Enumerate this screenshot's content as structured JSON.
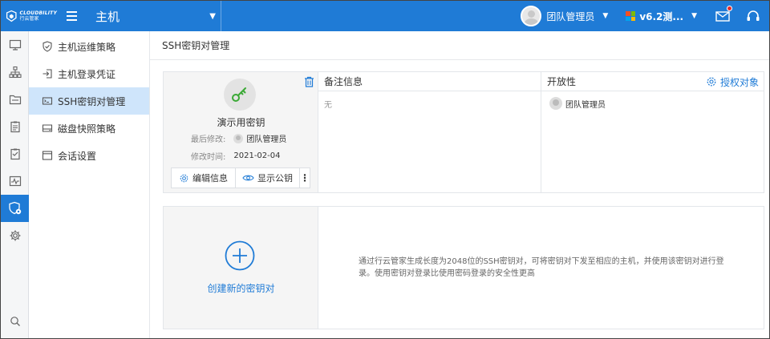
{
  "brand": {
    "name_en": "CLOUDBILITY",
    "name_cn": "行云管家"
  },
  "header": {
    "module": "主机",
    "user_name": "团队管理员",
    "version": "v6.2测..."
  },
  "colors": {
    "primary": "#1f7bd6",
    "active_menu": "#cfe5fb",
    "badge": "#e52b2b"
  },
  "rail": {
    "items": [
      {
        "icon": "monitor-icon"
      },
      {
        "icon": "topology-icon"
      },
      {
        "icon": "folder-icon"
      },
      {
        "icon": "clipboard-icon"
      },
      {
        "icon": "checklist-icon"
      },
      {
        "icon": "activity-icon"
      },
      {
        "icon": "shield-icon",
        "active": true
      },
      {
        "icon": "gear-icon"
      }
    ],
    "bottom": {
      "icon": "search-icon"
    }
  },
  "submenu": {
    "items": [
      {
        "label": "主机运维策略",
        "icon": "shield-check-icon"
      },
      {
        "label": "主机登录凭证",
        "icon": "login-icon"
      },
      {
        "label": "SSH密钥对管理",
        "icon": "key-icon",
        "active": true
      },
      {
        "label": "磁盘快照策略",
        "icon": "disk-icon"
      },
      {
        "label": "会话设置",
        "icon": "window-icon"
      }
    ]
  },
  "page": {
    "title": "SSH密钥对管理"
  },
  "key_card": {
    "name": "演示用密钥",
    "last_modified_label": "最后修改:",
    "last_modified_by": "团队管理员",
    "modified_time_label": "修改时间:",
    "modified_time": "2021-02-04",
    "edit_label": "编辑信息",
    "show_pubkey_label": "显示公钥",
    "more_label": "⋮",
    "notes_header": "备注信息",
    "notes_value": "无",
    "openness_header": "开放性",
    "authorize_label": "授权对象",
    "owner": "团队管理员"
  },
  "create_card": {
    "label": "创建新的密钥对",
    "description": "通过行云管家生成长度为2048位的SSH密钥对，可将密钥对下发至相应的主机，并使用该密钥对进行登录。使用密钥对登录比使用密码登录的安全性更高"
  }
}
